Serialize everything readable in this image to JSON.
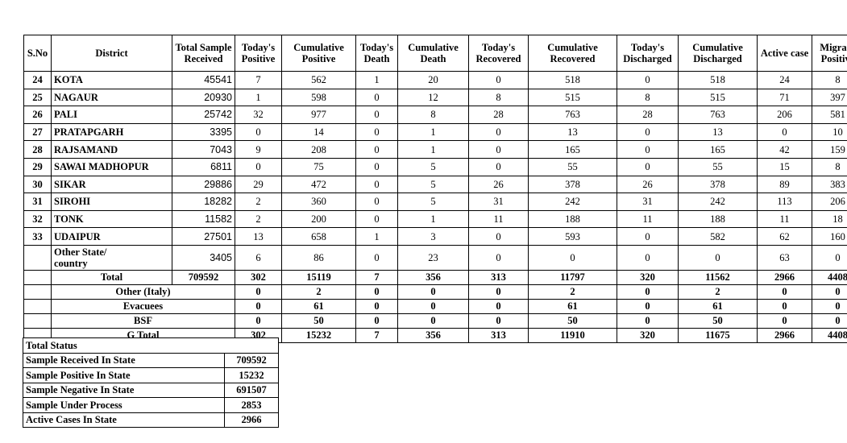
{
  "district_table": {
    "columns": [
      "S.No",
      "District",
      "Total Sample Received",
      "Today's Positive",
      "Cumulative Positive",
      "Today's Death",
      "Cumulative Death",
      "Today's Recovered",
      "Cumulative Recovered",
      "Today's Discharged",
      "Cumulative Discharged",
      "Active case",
      "Migrant Positive"
    ],
    "columns_split": [
      [
        "S.No",
        ""
      ],
      [
        "District",
        ""
      ],
      [
        "Total Sample",
        "Received"
      ],
      [
        "Today's",
        "Positive"
      ],
      [
        "Cumulative",
        "Positive"
      ],
      [
        "Today's",
        "Death"
      ],
      [
        "Cumulative",
        "Death"
      ],
      [
        "Today's",
        "Recovered"
      ],
      [
        "Cumulative",
        "Recovered"
      ],
      [
        "Today's",
        "Discharged"
      ],
      [
        "Cumulative",
        "Discharged"
      ],
      [
        "Active  case",
        ""
      ],
      [
        "Migrant",
        "Positive"
      ]
    ],
    "rows": [
      {
        "sno": "24",
        "district": "KOTA",
        "total_sample": "45541",
        "todays_positive": "7",
        "cumulative_positive": "562",
        "todays_death": "1",
        "cumulative_death": "20",
        "todays_recovered": "0",
        "cumulative_recovered": "518",
        "todays_discharged": "0",
        "cumulative_discharged": "518",
        "active_case": "24",
        "migrant_positive": "8"
      },
      {
        "sno": "25",
        "district": "NAGAUR",
        "total_sample": "20930",
        "todays_positive": "1",
        "cumulative_positive": "598",
        "todays_death": "0",
        "cumulative_death": "12",
        "todays_recovered": "8",
        "cumulative_recovered": "515",
        "todays_discharged": "8",
        "cumulative_discharged": "515",
        "active_case": "71",
        "migrant_positive": "397"
      },
      {
        "sno": "26",
        "district": "PALI",
        "total_sample": "25742",
        "todays_positive": "32",
        "cumulative_positive": "977",
        "todays_death": "0",
        "cumulative_death": "8",
        "todays_recovered": "28",
        "cumulative_recovered": "763",
        "todays_discharged": "28",
        "cumulative_discharged": "763",
        "active_case": "206",
        "migrant_positive": "581"
      },
      {
        "sno": "27",
        "district": "PRATAPGARH",
        "total_sample": "3395",
        "todays_positive": "0",
        "cumulative_positive": "14",
        "todays_death": "0",
        "cumulative_death": "1",
        "todays_recovered": "0",
        "cumulative_recovered": "13",
        "todays_discharged": "0",
        "cumulative_discharged": "13",
        "active_case": "0",
        "migrant_positive": "10"
      },
      {
        "sno": "28",
        "district": "RAJSAMAND",
        "total_sample": "7043",
        "todays_positive": "9",
        "cumulative_positive": "208",
        "todays_death": "0",
        "cumulative_death": "1",
        "todays_recovered": "0",
        "cumulative_recovered": "165",
        "todays_discharged": "0",
        "cumulative_discharged": "165",
        "active_case": "42",
        "migrant_positive": "159"
      },
      {
        "sno": "29",
        "district": "SAWAI MADHOPUR",
        "total_sample": "6811",
        "todays_positive": "0",
        "cumulative_positive": "75",
        "todays_death": "0",
        "cumulative_death": "5",
        "todays_recovered": "0",
        "cumulative_recovered": "55",
        "todays_discharged": "0",
        "cumulative_discharged": "55",
        "active_case": "15",
        "migrant_positive": "8"
      },
      {
        "sno": "30",
        "district": "SIKAR",
        "total_sample": "29886",
        "todays_positive": "29",
        "cumulative_positive": "472",
        "todays_death": "0",
        "cumulative_death": "5",
        "todays_recovered": "26",
        "cumulative_recovered": "378",
        "todays_discharged": "26",
        "cumulative_discharged": "378",
        "active_case": "89",
        "migrant_positive": "383"
      },
      {
        "sno": "31",
        "district": "SIROHI",
        "total_sample": "18282",
        "todays_positive": "2",
        "cumulative_positive": "360",
        "todays_death": "0",
        "cumulative_death": "5",
        "todays_recovered": "31",
        "cumulative_recovered": "242",
        "todays_discharged": "31",
        "cumulative_discharged": "242",
        "active_case": "113",
        "migrant_positive": "206"
      },
      {
        "sno": "32",
        "district": "TONK",
        "total_sample": "11582",
        "todays_positive": "2",
        "cumulative_positive": "200",
        "todays_death": "0",
        "cumulative_death": "1",
        "todays_recovered": "11",
        "cumulative_recovered": "188",
        "todays_discharged": "11",
        "cumulative_discharged": "188",
        "active_case": "11",
        "migrant_positive": "18"
      },
      {
        "sno": "33",
        "district": "UDAIPUR",
        "total_sample": "27501",
        "todays_positive": "13",
        "cumulative_positive": "658",
        "todays_death": "1",
        "cumulative_death": "3",
        "todays_recovered": "0",
        "cumulative_recovered": "593",
        "todays_discharged": "0",
        "cumulative_discharged": "582",
        "active_case": "62",
        "migrant_positive": "160"
      }
    ],
    "other_state_row": {
      "sno": "",
      "district_line1": "Other State/",
      "district_line2": "country",
      "total_sample": "3405",
      "todays_positive": "6",
      "cumulative_positive": "86",
      "todays_death": "0",
      "cumulative_death": "23",
      "todays_recovered": "0",
      "cumulative_recovered": "0",
      "todays_discharged": "0",
      "cumulative_discharged": "0",
      "active_case": "63",
      "migrant_positive": "0"
    },
    "total_row": {
      "label": "Total",
      "total_sample": "709592",
      "todays_positive": "302",
      "cumulative_positive": "15119",
      "todays_death": "7",
      "cumulative_death": "356",
      "todays_recovered": "313",
      "cumulative_recovered": "11797",
      "todays_discharged": "320",
      "cumulative_discharged": "11562",
      "active_case": "2966",
      "migrant_positive": "4408"
    },
    "sub_rows": [
      {
        "label": "Other (Italy)",
        "todays_positive": "0",
        "cumulative_positive": "2",
        "todays_death": "0",
        "cumulative_death": "0",
        "todays_recovered": "0",
        "cumulative_recovered": "2",
        "todays_discharged": "0",
        "cumulative_discharged": "2",
        "active_case": "0",
        "migrant_positive": "0"
      },
      {
        "label": "Evacuees",
        "todays_positive": "0",
        "cumulative_positive": "61",
        "todays_death": "0",
        "cumulative_death": "0",
        "todays_recovered": "0",
        "cumulative_recovered": "61",
        "todays_discharged": "0",
        "cumulative_discharged": "61",
        "active_case": "0",
        "migrant_positive": "0"
      },
      {
        "label": "BSF",
        "todays_positive": "0",
        "cumulative_positive": "50",
        "todays_death": "0",
        "cumulative_death": "0",
        "todays_recovered": "0",
        "cumulative_recovered": "50",
        "todays_discharged": "0",
        "cumulative_discharged": "50",
        "active_case": "0",
        "migrant_positive": "0"
      },
      {
        "label": "G Total",
        "todays_positive": "302",
        "cumulative_positive": "15232",
        "todays_death": "7",
        "cumulative_death": "356",
        "todays_recovered": "313",
        "cumulative_recovered": "11910",
        "todays_discharged": "320",
        "cumulative_discharged": "11675",
        "active_case": "2966",
        "migrant_positive": "4408"
      }
    ]
  },
  "summary_table": {
    "title": "Total Status",
    "rows": [
      {
        "label": "Sample Received In State",
        "value": "709592"
      },
      {
        "label": "Sample Positive In State",
        "value": "15232"
      },
      {
        "label": "Sample Negative In State",
        "value": "691507"
      },
      {
        "label": "Sample Under Process",
        "value": "2853"
      },
      {
        "label": "Active Cases In State",
        "value": "2966"
      }
    ]
  }
}
